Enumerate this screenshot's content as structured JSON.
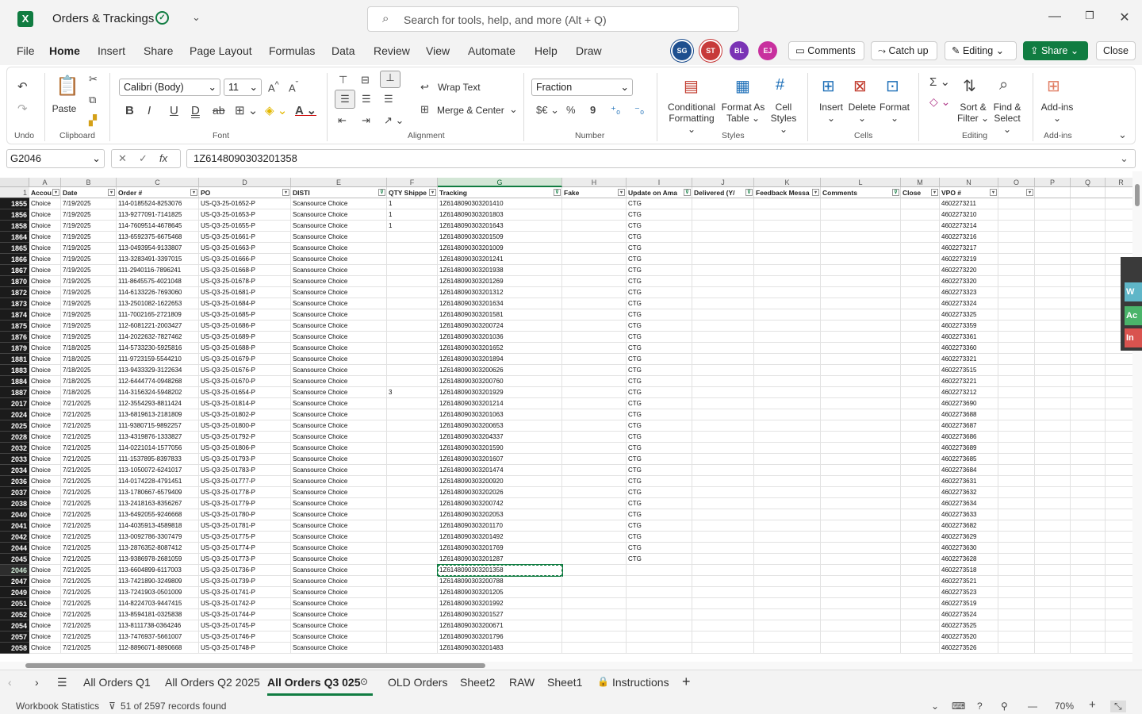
{
  "app": {
    "title": "Orders & Trackings",
    "logo_letter": "X",
    "search_placeholder": "Search for tools, help, and more (Alt + Q)"
  },
  "menu": [
    "File",
    "Home",
    "Insert",
    "Share",
    "Page Layout",
    "Formulas",
    "Data",
    "Review",
    "View",
    "Automate",
    "Help",
    "Draw"
  ],
  "collaborators": [
    {
      "initials": "SG",
      "color": "#1e4f8f"
    },
    {
      "initials": "ST",
      "color": "#c73a3a"
    },
    {
      "initials": "BL",
      "color": "#7a33b5"
    },
    {
      "initials": "EJ",
      "color": "#c8309e"
    }
  ],
  "topbuttons": {
    "comments": "Comments",
    "catchup": "Catch up",
    "editing": "Editing",
    "share": "Share",
    "close": "Close"
  },
  "ribbon": {
    "undo_group": "Undo",
    "clipboard_group": "Clipboard",
    "paste": "Paste",
    "font_name": "Calibri (Body)",
    "font_size": "11",
    "font_group": "Font",
    "wrap_text": "Wrap Text",
    "merge_center": "Merge & Center",
    "alignment_group": "Alignment",
    "number_format": "Fraction",
    "number_group": "Number",
    "conditional_1": "Conditional",
    "conditional_2": "Formatting",
    "format_as_1": "Format As",
    "format_as_2": "Table",
    "cell_styles_1": "Cell",
    "cell_styles_2": "Styles",
    "styles_group": "Styles",
    "insert": "Insert",
    "delete": "Delete",
    "format": "Format",
    "cells_group": "Cells",
    "sort_1": "Sort &",
    "sort_2": "Filter",
    "find_1": "Find &",
    "find_2": "Select",
    "editing_group": "Editing",
    "addins": "Add-ins",
    "addins_group": "Add-ins"
  },
  "formula": {
    "name_box": "G2046",
    "content": "1Z6148090303201358"
  },
  "columns": [
    "A",
    "B",
    "C",
    "D",
    "E",
    "F",
    "G",
    "H",
    "I",
    "J",
    "K",
    "L",
    "M",
    "N",
    "O",
    "P",
    "Q",
    "R"
  ],
  "headers": [
    "Accou",
    "Date",
    "Order #",
    "PO",
    "DISTI",
    "QTY Shippe",
    "Tracking",
    "Fake",
    "Update on Ama",
    "Delivered (Y/",
    "Feedback Messa",
    "Comments",
    "Close",
    "VPO #",
    "",
    "",
    "",
    ""
  ],
  "header_row_number": "1",
  "rows": [
    {
      "n": "1855",
      "acct": "Choice",
      "date": "7/19/2025",
      "order": "114-0185524-8253076",
      "po": "US-Q3-25-01652-P",
      "disti": "Scansource Choice",
      "qty": "1",
      "track": "1Z6148090303201410",
      "upd": "CTG",
      "vpo": "4602273211"
    },
    {
      "n": "1856",
      "acct": "Choice",
      "date": "7/19/2025",
      "order": "113-9277091-7141825",
      "po": "US-Q3-25-01653-P",
      "disti": "Scansource Choice",
      "qty": "1",
      "track": "1Z6148090303201803",
      "upd": "CTG",
      "vpo": "4602273210"
    },
    {
      "n": "1858",
      "acct": "Choice",
      "date": "7/19/2025",
      "order": "114-7609514-4678645",
      "po": "US-Q3-25-01655-P",
      "disti": "Scansource Choice",
      "qty": "1",
      "track": "1Z6148090303201643",
      "upd": "CTG",
      "vpo": "4602273214"
    },
    {
      "n": "1864",
      "acct": "Choice",
      "date": "7/19/2025",
      "order": "113-6592375-6675468",
      "po": "US-Q3-25-01661-P",
      "disti": "Scansource Choice",
      "qty": "",
      "track": "1Z6148090303201509",
      "upd": "CTG",
      "vpo": "4602273216"
    },
    {
      "n": "1865",
      "acct": "Choice",
      "date": "7/19/2025",
      "order": "113-0493954-9133807",
      "po": "US-Q3-25-01663-P",
      "disti": "Scansource Choice",
      "qty": "",
      "track": "1Z6148090303201009",
      "upd": "CTG",
      "vpo": "4602273217"
    },
    {
      "n": "1866",
      "acct": "Choice",
      "date": "7/19/2025",
      "order": "113-3283491-3397015",
      "po": "US-Q3-25-01666-P",
      "disti": "Scansource Choice",
      "qty": "",
      "track": "1Z6148090303201241",
      "upd": "CTG",
      "vpo": "4602273219"
    },
    {
      "n": "1867",
      "acct": "Choice",
      "date": "7/19/2025",
      "order": "111-2940116-7896241",
      "po": "US-Q3-25-01668-P",
      "disti": "Scansource Choice",
      "qty": "",
      "track": "1Z6148090303201938",
      "upd": "CTG",
      "vpo": "4602273220"
    },
    {
      "n": "1870",
      "acct": "Choice",
      "date": "7/19/2025",
      "order": "111-8645575-4021048",
      "po": "US-Q3-25-01678-P",
      "disti": "Scansource Choice",
      "qty": "",
      "track": "1Z6148090303201269",
      "upd": "CTG",
      "vpo": "4602273320"
    },
    {
      "n": "1872",
      "acct": "Choice",
      "date": "7/19/2025",
      "order": "114-6133226-7693060",
      "po": "US-Q3-25-01681-P",
      "disti": "Scansource Choice",
      "qty": "",
      "track": "1Z6148090303201312",
      "upd": "CTG",
      "vpo": "4602273323"
    },
    {
      "n": "1873",
      "acct": "Choice",
      "date": "7/19/2025",
      "order": "113-2501082-1622653",
      "po": "US-Q3-25-01684-P",
      "disti": "Scansource Choice",
      "qty": "",
      "track": "1Z6148090303201634",
      "upd": "CTG",
      "vpo": "4602273324"
    },
    {
      "n": "1874",
      "acct": "Choice",
      "date": "7/19/2025",
      "order": "111-7002165-2721809",
      "po": "US-Q3-25-01685-P",
      "disti": "Scansource Choice",
      "qty": "",
      "track": "1Z6148090303201581",
      "upd": "CTG",
      "vpo": "4602273325"
    },
    {
      "n": "1875",
      "acct": "Choice",
      "date": "7/19/2025",
      "order": "112-6081221-2003427",
      "po": "US-Q3-25-01686-P",
      "disti": "Scansource Choice",
      "qty": "",
      "track": "1Z6148090303200724",
      "upd": "CTG",
      "vpo": "4602273359"
    },
    {
      "n": "1876",
      "acct": "Choice",
      "date": "7/19/2025",
      "order": "114-2022632-7827462",
      "po": "US-Q3-25-01689-P",
      "disti": "Scansource Choice",
      "qty": "",
      "track": "1Z6148090303201036",
      "upd": "CTG",
      "vpo": "4602273361"
    },
    {
      "n": "1879",
      "acct": "Choice",
      "date": "7/18/2025",
      "order": "114-5733230-5925816",
      "po": "US-Q3-25-01688-P",
      "disti": "Scansource Choice",
      "qty": "",
      "track": "1Z6148090303201652",
      "upd": "CTG",
      "vpo": "4602273360"
    },
    {
      "n": "1881",
      "acct": "Choice",
      "date": "7/18/2025",
      "order": "111-9723159-5544210",
      "po": "US-Q3-25-01679-P",
      "disti": "Scansource Choice",
      "qty": "",
      "track": "1Z6148090303201894",
      "upd": "CTG",
      "vpo": "4602273321"
    },
    {
      "n": "1883",
      "acct": "Choice",
      "date": "7/18/2025",
      "order": "113-9433329-3122634",
      "po": "US-Q3-25-01676-P",
      "disti": "Scansource Choice",
      "qty": "",
      "track": "1Z6148090303200626",
      "upd": "CTG",
      "vpo": "4602273515"
    },
    {
      "n": "1884",
      "acct": "Choice",
      "date": "7/18/2025",
      "order": "112-6444774-0948268",
      "po": "US-Q3-25-01670-P",
      "disti": "Scansource Choice",
      "qty": "",
      "track": "1Z6148090303200760",
      "upd": "CTG",
      "vpo": "4602273221"
    },
    {
      "n": "1887",
      "acct": "Choice",
      "date": "7/18/2025",
      "order": "114-3156324-5948202",
      "po": "US-Q3-25-01654-P",
      "disti": "Scansource Choice",
      "qty": "3",
      "track": "1Z6148090303201929",
      "upd": "CTG",
      "vpo": "4602273212"
    },
    {
      "n": "2017",
      "acct": "Choice",
      "date": "7/21/2025",
      "order": "112-3554293-8811424",
      "po": "US-Q3-25-01814-P",
      "disti": "Scansource Choice",
      "qty": "",
      "track": "1Z6148090303201214",
      "upd": "CTG",
      "vpo": "4602273690"
    },
    {
      "n": "2024",
      "acct": "Choice",
      "date": "7/21/2025",
      "order": "113-6819613-2181809",
      "po": "US-Q3-25-01802-P",
      "disti": "Scansource Choice",
      "qty": "",
      "track": "1Z6148090303201063",
      "upd": "CTG",
      "vpo": "4602273688"
    },
    {
      "n": "2025",
      "acct": "Choice",
      "date": "7/21/2025",
      "order": "111-9380715-9892257",
      "po": "US-Q3-25-01800-P",
      "disti": "Scansource Choice",
      "qty": "",
      "track": "1Z6148090303200653",
      "upd": "CTG",
      "vpo": "4602273687"
    },
    {
      "n": "2028",
      "acct": "Choice",
      "date": "7/21/2025",
      "order": "113-4319876-1333827",
      "po": "US-Q3-25-01792-P",
      "disti": "Scansource Choice",
      "qty": "",
      "track": "1Z6148090303204337",
      "upd": "CTG",
      "vpo": "4602273686"
    },
    {
      "n": "2032",
      "acct": "Choice",
      "date": "7/21/2025",
      "order": "114-0221014-1577056",
      "po": "US-Q3-25-01806-P",
      "disti": "Scansource Choice",
      "qty": "",
      "track": "1Z6148090303201590",
      "upd": "CTG",
      "vpo": "4602273689"
    },
    {
      "n": "2033",
      "acct": "Choice",
      "date": "7/21/2025",
      "order": "111-1537895-8397833",
      "po": "US-Q3-25-01793-P",
      "disti": "Scansource Choice",
      "qty": "",
      "track": "1Z6148090303201607",
      "upd": "CTG",
      "vpo": "4602273685"
    },
    {
      "n": "2034",
      "acct": "Choice",
      "date": "7/21/2025",
      "order": "113-1050072-6241017",
      "po": "US-Q3-25-01783-P",
      "disti": "Scansource Choice",
      "qty": "",
      "track": "1Z6148090303201474",
      "upd": "CTG",
      "vpo": "4602273684"
    },
    {
      "n": "2036",
      "acct": "Choice",
      "date": "7/21/2025",
      "order": "114-0174228-4791451",
      "po": "US-Q3-25-01777-P",
      "disti": "Scansource Choice",
      "qty": "",
      "track": "1Z6148090303200920",
      "upd": "CTG",
      "vpo": "4602273631"
    },
    {
      "n": "2037",
      "acct": "Choice",
      "date": "7/21/2025",
      "order": "113-1780667-6579409",
      "po": "US-Q3-25-01778-P",
      "disti": "Scansource Choice",
      "qty": "",
      "track": "1Z6148090303202026",
      "upd": "CTG",
      "vpo": "4602273632"
    },
    {
      "n": "2038",
      "acct": "Choice",
      "date": "7/21/2025",
      "order": "113-2418163-8356267",
      "po": "US-Q3-25-01779-P",
      "disti": "Scansource Choice",
      "qty": "",
      "track": "1Z6148090303200742",
      "upd": "CTG",
      "vpo": "4602273634"
    },
    {
      "n": "2040",
      "acct": "Choice",
      "date": "7/21/2025",
      "order": "113-6492055-9246668",
      "po": "US-Q3-25-01780-P",
      "disti": "Scansource Choice",
      "qty": "",
      "track": "1Z6148090303202053",
      "upd": "CTG",
      "vpo": "4602273633"
    },
    {
      "n": "2041",
      "acct": "Choice",
      "date": "7/21/2025",
      "order": "114-4035913-4589818",
      "po": "US-Q3-25-01781-P",
      "disti": "Scansource Choice",
      "qty": "",
      "track": "1Z6148090303201170",
      "upd": "CTG",
      "vpo": "4602273682"
    },
    {
      "n": "2042",
      "acct": "Choice",
      "date": "7/21/2025",
      "order": "113-0092786-3307479",
      "po": "US-Q3-25-01775-P",
      "disti": "Scansource Choice",
      "qty": "",
      "track": "1Z6148090303201492",
      "upd": "CTG",
      "vpo": "4602273629"
    },
    {
      "n": "2044",
      "acct": "Choice",
      "date": "7/21/2025",
      "order": "113-2876352-8087412",
      "po": "US-Q3-25-01774-P",
      "disti": "Scansource Choice",
      "qty": "",
      "track": "1Z6148090303201769",
      "upd": "CTG",
      "vpo": "4602273630"
    },
    {
      "n": "2045",
      "acct": "Choice",
      "date": "7/21/2025",
      "order": "113-9386978-2681059",
      "po": "US-Q3-25-01773-P",
      "disti": "Scansource Choice",
      "qty": "",
      "track": "1Z6148090303201287",
      "upd": "CTG",
      "vpo": "4602273628"
    },
    {
      "n": "2046",
      "acct": "Choice",
      "date": "7/21/2025",
      "order": "113-6604899-6117003",
      "po": "US-Q3-25-01736-P",
      "disti": "Scansource Choice",
      "qty": "",
      "track": "1Z6148090303201358",
      "upd": "",
      "vpo": "4602273518"
    },
    {
      "n": "2047",
      "acct": "Choice",
      "date": "7/21/2025",
      "order": "113-7421890-3249809",
      "po": "US-Q3-25-01739-P",
      "disti": "Scansource Choice",
      "qty": "",
      "track": "1Z6148090303200788",
      "upd": "",
      "vpo": "4602273521"
    },
    {
      "n": "2049",
      "acct": "Choice",
      "date": "7/21/2025",
      "order": "113-7241903-0501009",
      "po": "US-Q3-25-01741-P",
      "disti": "Scansource Choice",
      "qty": "",
      "track": "1Z6148090303201205",
      "upd": "",
      "vpo": "4602273523"
    },
    {
      "n": "2051",
      "acct": "Choice",
      "date": "7/21/2025",
      "order": "114-8224703-9447415",
      "po": "US-Q3-25-01742-P",
      "disti": "Scansource Choice",
      "qty": "",
      "track": "1Z6148090303201992",
      "upd": "",
      "vpo": "4602273519"
    },
    {
      "n": "2052",
      "acct": "Choice",
      "date": "7/21/2025",
      "order": "113-8594181-0325838",
      "po": "US-Q3-25-01744-P",
      "disti": "Scansource Choice",
      "qty": "",
      "track": "1Z6148090303201527",
      "upd": "",
      "vpo": "4602273524"
    },
    {
      "n": "2054",
      "acct": "Choice",
      "date": "7/21/2025",
      "order": "113-8111738-0364246",
      "po": "US-Q3-25-01745-P",
      "disti": "Scansource Choice",
      "qty": "",
      "track": "1Z6148090303200671",
      "upd": "",
      "vpo": "4602273525"
    },
    {
      "n": "2057",
      "acct": "Choice",
      "date": "7/21/2025",
      "order": "113-7476937-5661007",
      "po": "US-Q3-25-01746-P",
      "disti": "Scansource Choice",
      "qty": "",
      "track": "1Z6148090303201796",
      "upd": "",
      "vpo": "4602273520"
    },
    {
      "n": "2058",
      "acct": "Choice",
      "date": "7/21/2025",
      "order": "112-8896071-8890668",
      "po": "US-Q3-25-01748-P",
      "disti": "Scansource Choice",
      "qty": "",
      "track": "1Z6148090303201483",
      "upd": "",
      "vpo": "4602273526"
    }
  ],
  "side_panel": [
    "W",
    "Ac",
    "In"
  ],
  "side_panel_colors": [
    "#5fb6c8",
    "#4ab46a",
    "#d9534f"
  ],
  "tabs": [
    "All Orders Q1",
    "All Orders Q2 2025",
    "All Orders Q3 025",
    "OLD Orders",
    "Sheet2",
    "RAW",
    "Sheet1",
    "Instructions"
  ],
  "status": {
    "stats": "Workbook Statistics",
    "records": "51 of 2597 records found",
    "zoom": "70%"
  }
}
